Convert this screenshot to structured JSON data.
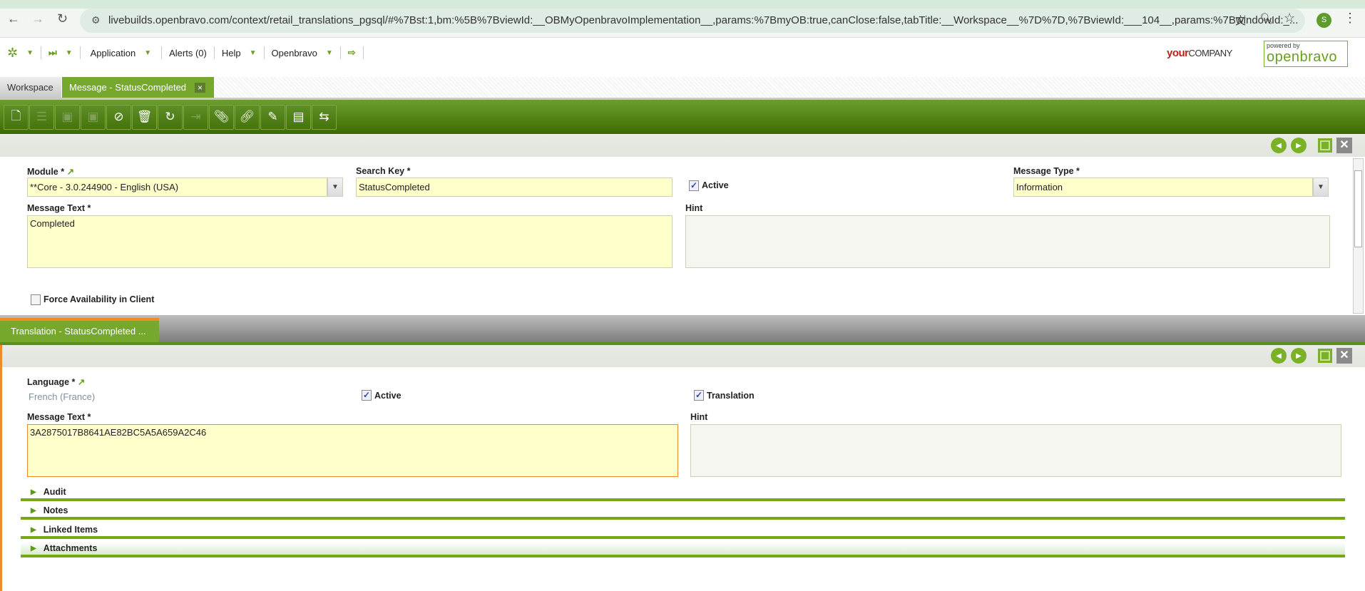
{
  "browser": {
    "url": "livebuilds.openbravo.com/context/retail_translations_pgsql/#%7Bst:1,bm:%5B%7BviewId:__OBMyOpenbravoImplementation__,params:%7BmyOB:true,canClose:false,tabTitle:__Workspace__%7D%7D,%7BviewId:___104__,params:%7BwindowId:_...",
    "profile_initial": "S"
  },
  "menu": {
    "application": "Application",
    "alerts": "Alerts (0)",
    "help": "Help",
    "openbravo": "Openbravo"
  },
  "logos": {
    "company_your": "your",
    "company_rest": "COMPANY",
    "powered_by": "powered by",
    "openbravo": "openbravo"
  },
  "tabs": {
    "workspace": "Workspace",
    "message": "Message - StatusCompleted",
    "close": "×"
  },
  "form": {
    "module_label": "Module *",
    "module_value": "**Core - 3.0.244900 - English (USA)",
    "search_key_label": "Search Key *",
    "search_key_value": "StatusCompleted",
    "active_label": "Active",
    "message_type_label": "Message Type *",
    "message_type_value": "Information",
    "message_text_label": "Message Text *",
    "message_text_value": "Completed",
    "hint_label": "Hint",
    "force_label": "Force Availability in Client"
  },
  "child_tab": {
    "label": "Translation - StatusCompleted ..."
  },
  "translation": {
    "language_label": "Language *",
    "language_value": "French (France)",
    "active_label": "Active",
    "translation_label": "Translation",
    "message_text_label": "Message Text *",
    "message_text_value": "3A2875017B8641AE82BC5A5A659A2C46",
    "hint_label": "Hint"
  },
  "sections": [
    "Audit",
    "Notes",
    "Linked Items",
    "Attachments"
  ]
}
